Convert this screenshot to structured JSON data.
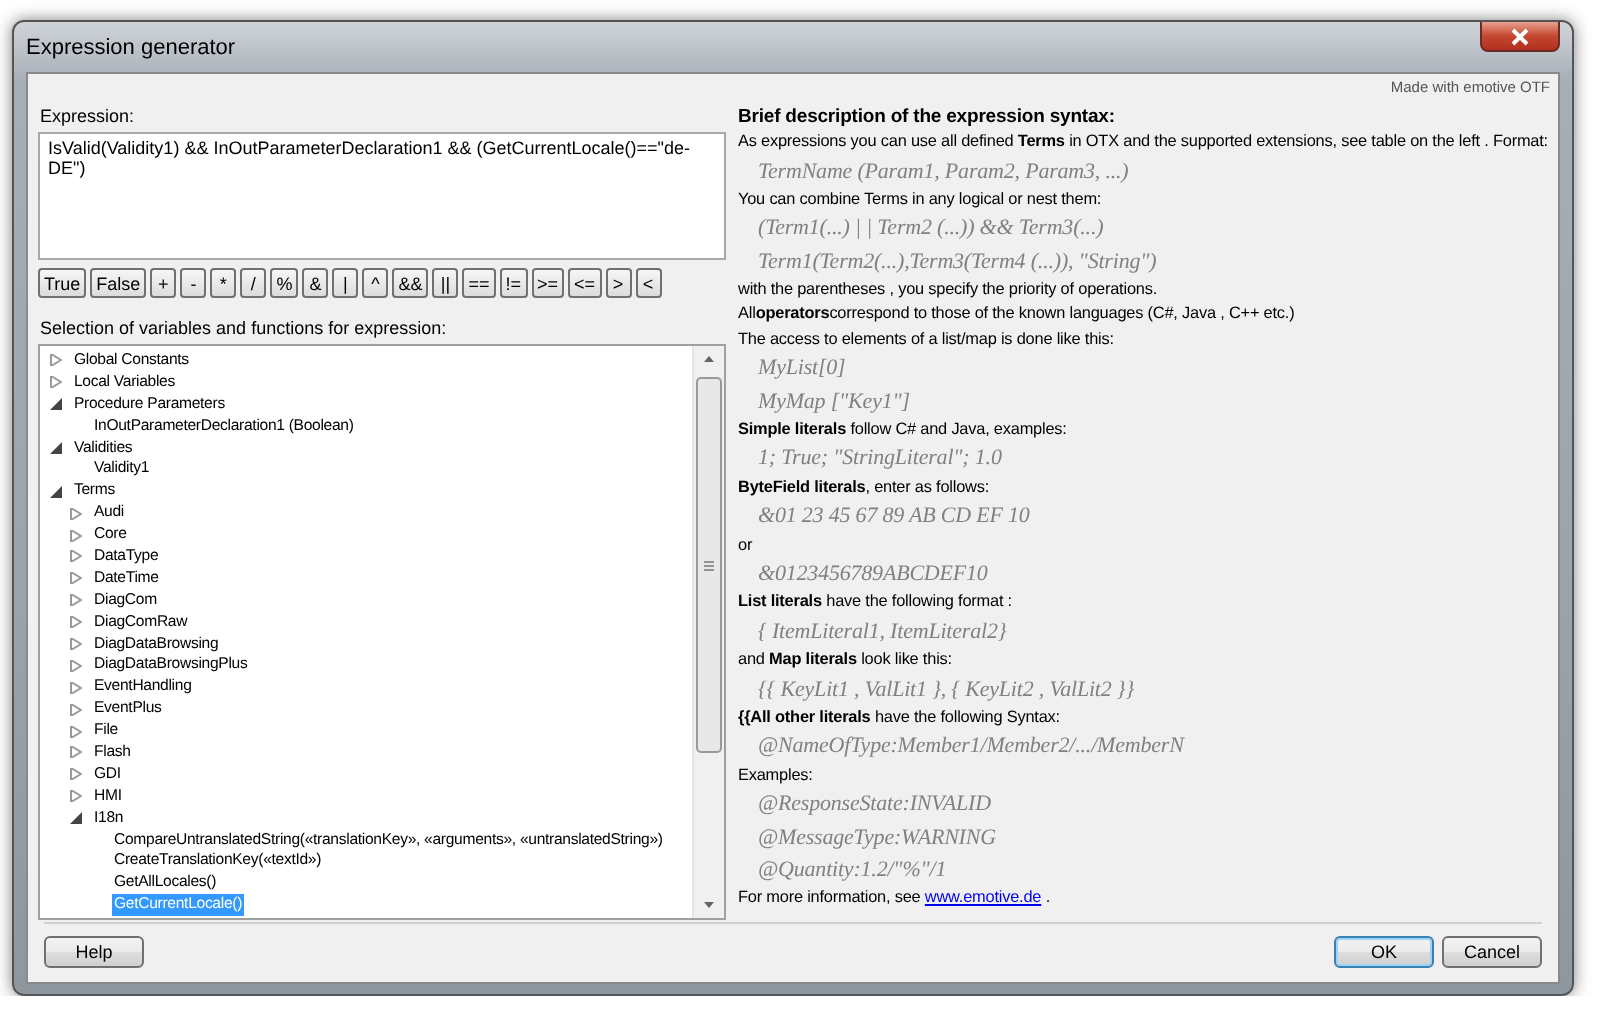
{
  "window": {
    "title": "Expression generator",
    "branding": "Made with emotive OTF"
  },
  "expression": {
    "label": "Expression:",
    "value": "IsValid(Validity1) && InOutParameterDeclaration1 && (GetCurrentLocale()==\"de-DE\")"
  },
  "operators": [
    "True",
    "False",
    "+",
    "-",
    "*",
    "/",
    "%",
    "&",
    "|",
    "^",
    "&&",
    "||",
    "==",
    "!=",
    ">=",
    "<=",
    ">",
    "<"
  ],
  "selection": {
    "label": "Selection of variables and functions for expression:",
    "tree": [
      {
        "label": "Global Constants",
        "expanded": false,
        "selected": false
      },
      {
        "label": "Local Variables",
        "expanded": false,
        "selected": false
      },
      {
        "label": "Procedure Parameters",
        "expanded": true,
        "selected": false,
        "children": [
          {
            "label": "InOutParameterDeclaration1 (Boolean)",
            "selected": false
          }
        ]
      },
      {
        "label": "Validities",
        "expanded": true,
        "selected": false,
        "children": [
          {
            "label": "Validity1",
            "selected": false
          }
        ]
      },
      {
        "label": "Terms",
        "expanded": true,
        "selected": false,
        "children": [
          {
            "label": "Audi",
            "expanded": false,
            "selected": false
          },
          {
            "label": "Core",
            "expanded": false,
            "selected": false
          },
          {
            "label": "DataType",
            "expanded": false,
            "selected": false
          },
          {
            "label": "DateTime",
            "expanded": false,
            "selected": false
          },
          {
            "label": "DiagCom",
            "expanded": false,
            "selected": false
          },
          {
            "label": "DiagComRaw",
            "expanded": false,
            "selected": false
          },
          {
            "label": "DiagDataBrowsing",
            "expanded": false,
            "selected": false
          },
          {
            "label": "DiagDataBrowsingPlus",
            "expanded": false,
            "selected": false
          },
          {
            "label": "EventHandling",
            "expanded": false,
            "selected": false
          },
          {
            "label": "EventPlus",
            "expanded": false,
            "selected": false
          },
          {
            "label": "File",
            "expanded": false,
            "selected": false
          },
          {
            "label": "Flash",
            "expanded": false,
            "selected": false
          },
          {
            "label": "GDI",
            "expanded": false,
            "selected": false
          },
          {
            "label": "HMI",
            "expanded": false,
            "selected": false
          },
          {
            "label": "I18n",
            "expanded": true,
            "selected": false,
            "children": [
              {
                "label": "CompareUntranslatedString(«translationKey», «arguments», «untranslatedString»)",
                "selected": false
              },
              {
                "label": "CreateTranslationKey(«textId»)",
                "selected": false
              },
              {
                "label": "GetAllLocales()",
                "selected": false
              },
              {
                "label": "GetCurrentLocale()",
                "selected": true
              }
            ]
          }
        ]
      }
    ]
  },
  "syntax_help": {
    "title": "Brief description of the expression syntax:",
    "lines": [
      {
        "kind": "text",
        "text": "As expressions you can use all defined **Terms** in OTX and the supported extensions, see table on the left . Format:"
      },
      {
        "kind": "code",
        "text": "TermName (Param1, Param2, Param3, ...)"
      },
      {
        "kind": "text",
        "text": " You can combine Terms in any logical or nest them:"
      },
      {
        "kind": "code",
        "text": "(Term1(...) | | Term2 (...)) && Term3(...)"
      },
      {
        "kind": "code",
        "text": "Term1(Term2(...),Term3(Term4 (...)), \"String\")"
      },
      {
        "kind": "text",
        "text": " with the parentheses , you specify the priority of operations."
      },
      {
        "kind": "text",
        "text": "All**operators**correspond to those of the known languages (C#, Java , C++ etc.)"
      },
      {
        "kind": "text",
        "text": "The access to elements of a list/map is done like this:"
      },
      {
        "kind": "code",
        "text": "MyList[0]"
      },
      {
        "kind": "code",
        "text": "MyMap [\"Key1\"]"
      },
      {
        "kind": "text",
        "text": "**Simple literals** follow C# and Java, examples:"
      },
      {
        "kind": "code",
        "text": "1; True; \"StringLiteral\"; 1.0"
      },
      {
        "kind": "text",
        "text": "**ByteField literals**, enter as follows:"
      },
      {
        "kind": "code",
        "text": "&01 23 45 67 89 AB CD EF 10"
      },
      {
        "kind": "text",
        "text": " or"
      },
      {
        "kind": "code",
        "text": "&0123456789ABCDEF10"
      },
      {
        "kind": "text",
        "text": "**List literals** have the following format :"
      },
      {
        "kind": "code",
        "text": "{ ItemLiteral1, ItemLiteral2}"
      },
      {
        "kind": "text",
        "text": " and **Map literals**  look like this:"
      },
      {
        "kind": "code",
        "text": "{{ KeyLit1 , ValLit1 }, { KeyLit2 , ValLit2 }}"
      },
      {
        "kind": "text",
        "text": "**{{All other literals**  have the following Syntax:"
      },
      {
        "kind": "code",
        "text": "@NameOfType:Member1/Member2/.../MemberN"
      },
      {
        "kind": "text",
        "text": "Examples:"
      },
      {
        "kind": "code",
        "text": "@ResponseState:INVALID"
      },
      {
        "kind": "code",
        "text": "@MessageType:WARNING"
      },
      {
        "kind": "code",
        "text": "@Quantity:1.2/\"%\"/1"
      },
      {
        "kind": "link",
        "text": "For more information, see ",
        "link": "www.emotive.de",
        "after": " ."
      }
    ]
  },
  "footer": {
    "left": [
      {
        "label": "Help",
        "default": false
      }
    ],
    "right": [
      {
        "label": "OK",
        "default": true
      },
      {
        "label": "Cancel",
        "default": false
      }
    ]
  }
}
